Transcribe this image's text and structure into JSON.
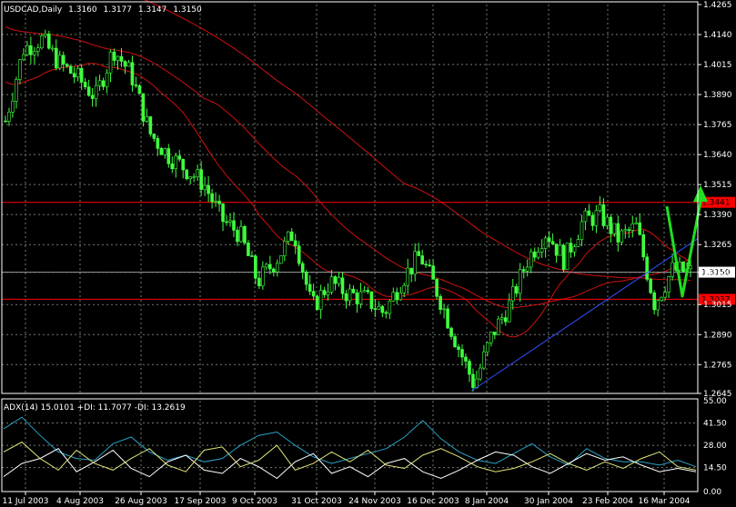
{
  "chart_data": [
    {
      "type": "candlestick",
      "symbol_label": "USDCAD,Daily",
      "ohlc_header": [
        "1.3160",
        "1.3177",
        "1.3147",
        "1.3150"
      ],
      "ylim": [
        1.2645,
        1.4265
      ],
      "y_tick_labels": [
        "1.4265",
        "1.4140",
        "1.4015",
        "1.3890",
        "1.3765",
        "1.3640",
        "1.3515",
        "1.3390",
        "1.3265",
        "1.3150",
        "1.3015",
        "1.2890",
        "1.2765",
        "1.2645"
      ],
      "y_tick_values": [
        1.4265,
        1.414,
        1.4015,
        1.389,
        1.3765,
        1.364,
        1.3515,
        1.339,
        1.3265,
        1.315,
        1.3015,
        1.289,
        1.2765,
        1.2645
      ],
      "x_tick_labels": [
        "11 Jul 2003",
        "4 Aug 2003",
        "26 Aug 2003",
        "17 Sep 2003",
        "9 Oct 2003",
        "31 Oct 2003",
        "24 Nov 2003",
        "16 Dec 2003",
        "8 Jan 2004",
        "30 Jan 2004",
        "23 Feb 2004",
        "16 Mar 2004"
      ],
      "close_price_path": {
        "dates": [
          "2003-07-11",
          "2003-07-18",
          "2003-07-25",
          "2003-08-01",
          "2003-08-08",
          "2003-08-15",
          "2003-08-22",
          "2003-08-29",
          "2003-09-05",
          "2003-09-12",
          "2003-09-19",
          "2003-09-26",
          "2003-10-03",
          "2003-10-10",
          "2003-10-17",
          "2003-10-24",
          "2003-10-31",
          "2003-11-07",
          "2003-11-14",
          "2003-11-21",
          "2003-11-28",
          "2003-12-05",
          "2003-12-12",
          "2003-12-19",
          "2003-12-26",
          "2004-01-02",
          "2004-01-09",
          "2004-01-16",
          "2004-01-23",
          "2004-01-30",
          "2004-02-06",
          "2004-02-13",
          "2004-02-20",
          "2004-02-27",
          "2004-03-05",
          "2004-03-12",
          "2004-03-19",
          "2004-03-26",
          "2004-03-31"
        ],
        "values": [
          1.378,
          1.408,
          1.412,
          1.402,
          1.396,
          1.388,
          1.408,
          1.397,
          1.373,
          1.364,
          1.358,
          1.352,
          1.337,
          1.331,
          1.311,
          1.32,
          1.332,
          1.3,
          1.311,
          1.306,
          1.304,
          1.298,
          1.312,
          1.322,
          1.306,
          1.286,
          1.268,
          1.289,
          1.302,
          1.321,
          1.332,
          1.32,
          1.336,
          1.339,
          1.329,
          1.334,
          1.302,
          1.316,
          1.315
        ]
      },
      "horizontal_levels": [
        {
          "value": 1.3441,
          "label": "1.3441",
          "color": "#ff0000"
        },
        {
          "value": 1.3037,
          "label": "1.3037",
          "color": "#ff0000"
        }
      ],
      "current_price": {
        "value": 1.315,
        "label": "1.3150"
      },
      "trendline_color": "#3050ff",
      "ma_color": "#d01010",
      "candle_color": "#40ff40",
      "projection_color": "#20e020"
    },
    {
      "type": "line",
      "indicator_label": "ADX(14) 15.0101 +DI: 11.7077 -DI: 13.2619",
      "ylim": [
        0,
        55
      ],
      "y_tick_labels": [
        "55.00",
        "41.50",
        "28.00",
        "14.50",
        "0.00"
      ],
      "y_tick_values": [
        55,
        41.5,
        28,
        14.5,
        0
      ],
      "series": [
        {
          "name": "ADX",
          "color": "#29a3c8",
          "values": [
            38,
            45,
            34,
            24,
            20,
            19,
            29,
            33,
            24,
            19,
            22,
            18,
            20,
            28,
            34,
            36,
            28,
            21,
            17,
            20,
            23,
            26,
            33,
            43,
            32,
            24,
            19,
            17,
            23,
            29,
            21,
            16,
            26,
            20,
            18,
            18,
            16,
            19,
            15
          ]
        },
        {
          "name": "+DI",
          "color": "#ffffff",
          "values": [
            9,
            17,
            20,
            26,
            12,
            18,
            25,
            14,
            9,
            18,
            22,
            13,
            11,
            20,
            15,
            8,
            18,
            23,
            11,
            15,
            9,
            17,
            20,
            12,
            8,
            13,
            19,
            24,
            22,
            15,
            11,
            17,
            23,
            19,
            21,
            16,
            12,
            14,
            12
          ]
        },
        {
          "name": "-DI",
          "color": "#e5e57a",
          "values": [
            24,
            30,
            20,
            13,
            25,
            17,
            13,
            20,
            26,
            16,
            12,
            25,
            27,
            15,
            19,
            28,
            13,
            17,
            24,
            18,
            25,
            16,
            14,
            22,
            26,
            21,
            15,
            12,
            14,
            18,
            23,
            17,
            13,
            18,
            14,
            20,
            24,
            15,
            13
          ]
        }
      ]
    }
  ]
}
